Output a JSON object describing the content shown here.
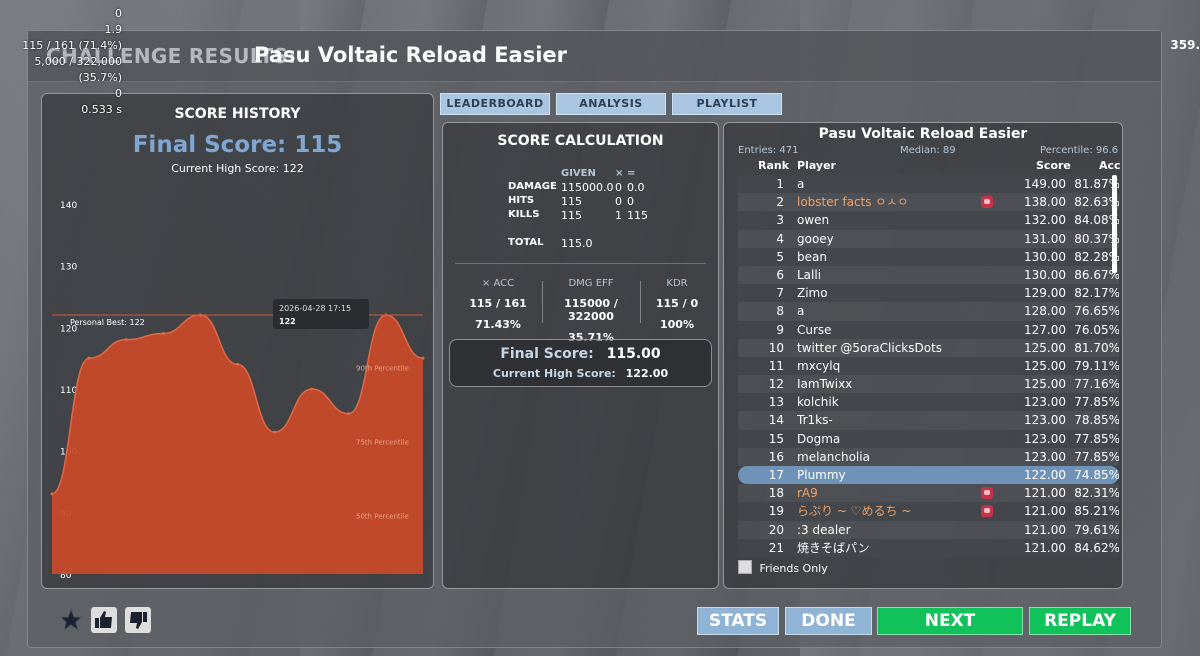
{
  "overlay": {
    "lines": [
      "0",
      "1.9",
      "115 / 161  (71.4%)",
      "5,000 / 322,000  (35.7%)",
      "0",
      "0.533 s"
    ],
    "fps": "359."
  },
  "title": {
    "prefix": "CHALLENGE RESULTS:",
    "name": "Pasu Voltaic Reload Easier"
  },
  "tabs": [
    "LEADERBOARD",
    "ANALYSIS",
    "PLAYLIST"
  ],
  "history": {
    "title": "SCORE HISTORY",
    "final_score": "Final Score: 115",
    "high_score": "Current High Score: 122",
    "tooltip_date": "2026-04-28 17:15",
    "tooltip_value": "122",
    "personal_best_label": "Personal Best: 122",
    "percentile_labels": [
      "90th Percentile",
      "75th Percentile",
      "50th Percentile"
    ]
  },
  "chart_data": {
    "type": "area",
    "title": "SCORE HISTORY",
    "xlabel": "",
    "ylabel": "",
    "ylim": [
      80,
      140
    ],
    "yticks": [
      80,
      90,
      100,
      110,
      120,
      130,
      140
    ],
    "values": [
      93,
      115,
      118,
      119,
      122,
      114,
      103,
      110,
      106,
      122,
      115
    ],
    "reference_lines": [
      {
        "label": "Personal Best: 122",
        "value": 122
      }
    ],
    "color": "#c74a2b",
    "grid": false
  },
  "calc": {
    "title": "SCORE CALCULATION",
    "given_header": "GIVEN",
    "mult_header": "×",
    "eq_header": "=",
    "rows": [
      {
        "label": "DAMAGE",
        "given": "115000.0",
        "mult": "0",
        "result": "0.0"
      },
      {
        "label": "HITS",
        "given": "115",
        "mult": "0",
        "result": "0"
      },
      {
        "label": "KILLS",
        "given": "115",
        "mult": "1",
        "result": "115"
      }
    ],
    "total_label": "TOTAL",
    "total_value": "115.0",
    "stats": [
      {
        "header": "× ACC",
        "a": "115 / 161",
        "b": "71.43%"
      },
      {
        "header": "DMG EFF",
        "a": "115000 / 322000",
        "b": "35.71%"
      },
      {
        "header": "KDR",
        "a": "115 / 0",
        "b": "100%"
      }
    ],
    "final_label": "Final Score:",
    "final_value": "115.00",
    "high_label": "Current High Score:",
    "high_value": "122.00"
  },
  "board": {
    "title": "Pasu Voltaic Reload Easier",
    "entries": "Entries: 471",
    "median": "Median: 89",
    "percentile": "Percentile: 96.6",
    "headers": {
      "rank": "Rank",
      "player": "Player",
      "score": "Score",
      "acc": "Acc"
    },
    "rows": [
      {
        "rank": "1",
        "name": "a",
        "score": "149.00",
        "acc": "81.87%"
      },
      {
        "rank": "2",
        "name": "lobster facts ㅇㅅㅇ",
        "score": "138.00",
        "acc": "82.63%",
        "friend": true
      },
      {
        "rank": "3",
        "name": "owen",
        "score": "132.00",
        "acc": "84.08%"
      },
      {
        "rank": "4",
        "name": "gooey",
        "score": "131.00",
        "acc": "80.37%"
      },
      {
        "rank": "5",
        "name": "bean",
        "score": "130.00",
        "acc": "82.28%"
      },
      {
        "rank": "6",
        "name": "Lalli",
        "score": "130.00",
        "acc": "86.67%"
      },
      {
        "rank": "7",
        "name": "Zimo",
        "score": "129.00",
        "acc": "82.17%"
      },
      {
        "rank": "8",
        "name": "a",
        "score": "128.00",
        "acc": "76.65%"
      },
      {
        "rank": "9",
        "name": "Curse",
        "score": "127.00",
        "acc": "76.05%"
      },
      {
        "rank": "10",
        "name": "twitter @5oraClicksDots",
        "score": "125.00",
        "acc": "81.70%"
      },
      {
        "rank": "11",
        "name": "mxcylq",
        "score": "125.00",
        "acc": "79.11%"
      },
      {
        "rank": "12",
        "name": "IamTwixx",
        "score": "125.00",
        "acc": "77.16%"
      },
      {
        "rank": "13",
        "name": "kolchik",
        "score": "123.00",
        "acc": "77.85%"
      },
      {
        "rank": "14",
        "name": "Tr1ks-",
        "score": "123.00",
        "acc": "78.85%"
      },
      {
        "rank": "15",
        "name": "Dogma",
        "score": "123.00",
        "acc": "77.85%"
      },
      {
        "rank": "16",
        "name": "melancholia",
        "score": "123.00",
        "acc": "77.85%"
      },
      {
        "rank": "17",
        "name": "Plummy",
        "score": "122.00",
        "acc": "74.85%",
        "me": true
      },
      {
        "rank": "18",
        "name": "rA9",
        "score": "121.00",
        "acc": "82.31%",
        "friend": true
      },
      {
        "rank": "19",
        "name": "らぷり ~ ♡めるち ~",
        "score": "121.00",
        "acc": "85.21%",
        "friend": true
      },
      {
        "rank": "20",
        "name": ":3 dealer",
        "score": "121.00",
        "acc": "79.61%"
      },
      {
        "rank": "21",
        "name": "焼きそばパン",
        "score": "121.00",
        "acc": "84.62%"
      }
    ],
    "friends_only": "Friends Only"
  },
  "buttons": {
    "stats": "STATS",
    "done": "DONE",
    "next": "NEXT",
    "replay": "REPLAY"
  },
  "icons": {
    "favorite": "star-icon",
    "like": "thumbs-up-icon",
    "dislike": "thumbs-down-icon"
  }
}
